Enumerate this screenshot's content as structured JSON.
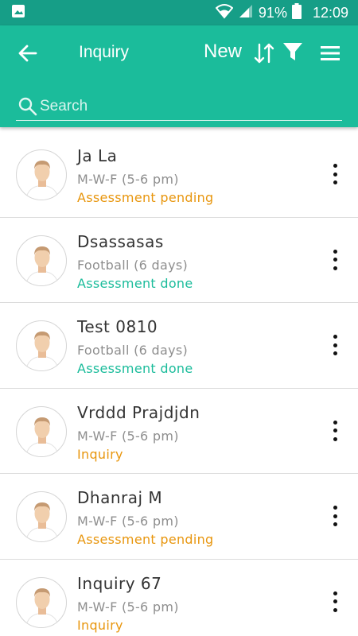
{
  "status_bar": {
    "battery": "91%",
    "time": "12:09",
    "icons": [
      "image-notification-icon",
      "wifi-icon",
      "signal-icon",
      "battery-icon"
    ]
  },
  "toolbar": {
    "title": "Inquiry",
    "new_label": "New",
    "icons": [
      "back-arrow-icon",
      "sort-icon",
      "filter-icon",
      "menu-icon"
    ]
  },
  "search": {
    "placeholder": "Search",
    "value": ""
  },
  "colors": {
    "primary": "#1bbc9b",
    "primary_dark": "#169e87",
    "status_pending": "#e8960e",
    "status_done": "#1bbc9b"
  },
  "inquiries": [
    {
      "name": "Ja La",
      "schedule": "M-W-F (5-6 pm)",
      "status": "Assessment pending",
      "status_color": "#e8960e"
    },
    {
      "name": "Dsassasas",
      "schedule": "Football (6 days)",
      "status": "Assessment done",
      "status_color": "#1bbc9b"
    },
    {
      "name": "Test 0810",
      "schedule": "Football (6 days)",
      "status": "Assessment done",
      "status_color": "#1bbc9b"
    },
    {
      "name": "Vrddd Prajdjdn",
      "schedule": "M-W-F (5-6 pm)",
      "status": "Inquiry",
      "status_color": "#e8960e"
    },
    {
      "name": "Dhanraj M",
      "schedule": "M-W-F (5-6 pm)",
      "status": "Assessment pending",
      "status_color": "#e8960e"
    },
    {
      "name": "Inquiry 67",
      "schedule": "M-W-F (5-6 pm)",
      "status": "Inquiry",
      "status_color": "#e8960e"
    }
  ]
}
